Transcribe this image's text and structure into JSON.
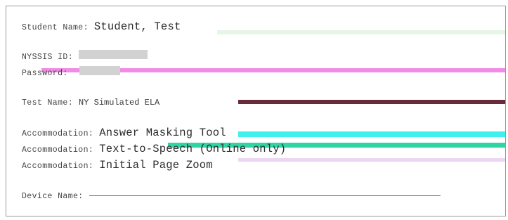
{
  "ticket": {
    "student_name_label": "Student Name:",
    "student_name_value": "Student, Test",
    "ssid_label": "NYSSIS ID:",
    "password_label": "Password:",
    "test_name_label": "Test Name:",
    "test_name_value": "NY Simulated ELA",
    "accommodations": [
      {
        "label": "Accommodation:",
        "value": "Answer Masking Tool"
      },
      {
        "label": "Accommodation:",
        "value": "Text-to-Speech (Online only)"
      },
      {
        "label": "Accommodation:",
        "value": "Initial Page Zoom"
      }
    ],
    "device_name_label": "Device Name:"
  },
  "colors": {
    "border": "#9a9a9a",
    "streak_magenta": "#f08ce6",
    "streak_maroon": "#6a2a3a",
    "streak_cyan": "#3ff0ec",
    "streak_teal": "#2fd6a4",
    "streak_lavender": "#ecd6f4",
    "streak_pale_green": "#e6f6e6",
    "redaction": "#d2d2d2"
  }
}
